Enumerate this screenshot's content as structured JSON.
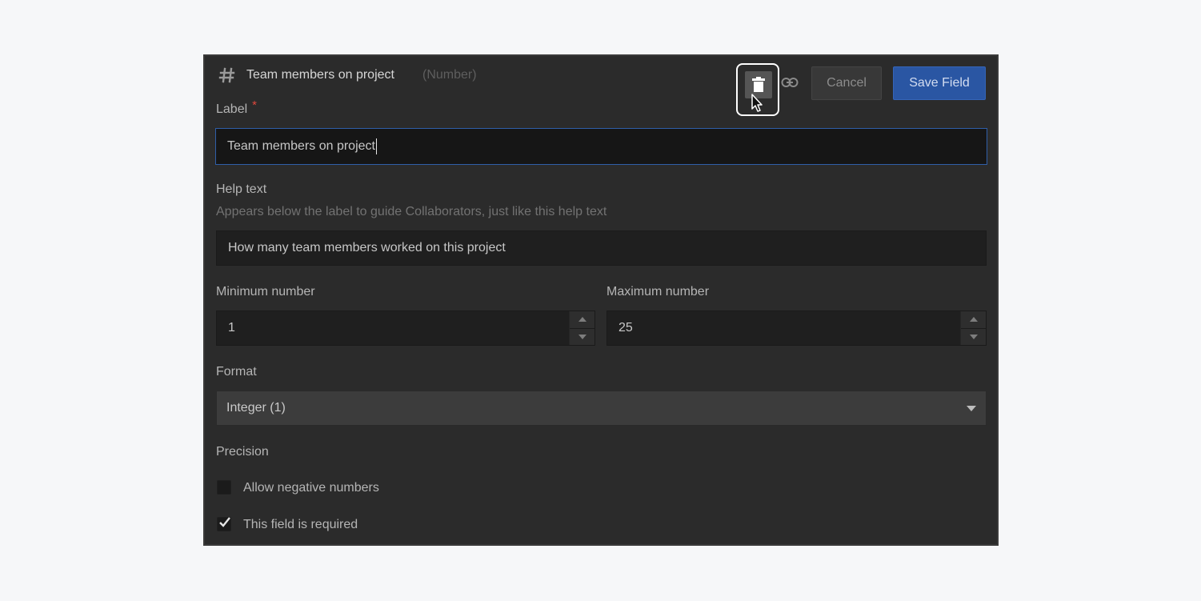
{
  "header": {
    "type_icon": "hash-icon",
    "field_name": "Team members on project",
    "field_type": "(Number)",
    "delete_icon": "trash-icon",
    "link_icon": "link-icon",
    "cancel_label": "Cancel",
    "save_label": "Save Field"
  },
  "label_field": {
    "label": "Label",
    "required_marker": "*",
    "value": "Team members on project"
  },
  "help_text_field": {
    "label": "Help text",
    "description": "Appears below the label to guide Collaborators, just like this help text",
    "value": "How many team members worked on this project"
  },
  "min_number": {
    "label": "Minimum number",
    "value": "1"
  },
  "max_number": {
    "label": "Maximum number",
    "value": "25"
  },
  "format": {
    "label": "Format",
    "selected": "Integer (1)"
  },
  "precision": {
    "label": "Precision"
  },
  "options": {
    "allow_negative": {
      "label": "Allow negative numbers",
      "checked": false
    },
    "required": {
      "label": "This field is required",
      "checked": true
    }
  },
  "colors": {
    "panel_bg": "#2b2b2b",
    "accent_blue": "#2a56a3",
    "required_red": "#e0483d"
  }
}
